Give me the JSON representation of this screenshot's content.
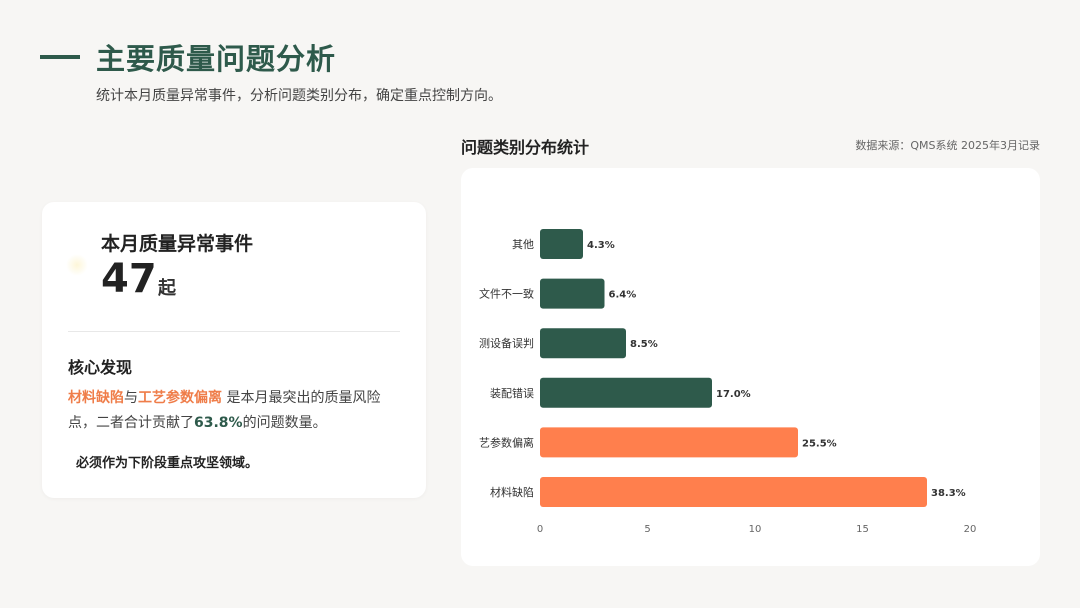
{
  "header": {
    "title": "主要质量问题分析",
    "subtitle": "统计本月质量异常事件，分析问题类别分布，确定重点控制方向。"
  },
  "summary_card": {
    "metric_label": "本月质量异常事件",
    "metric_value": "47",
    "metric_unit": "起",
    "core_title": "核心发现",
    "finding": {
      "item1": "材料缺陷",
      "conj": "与",
      "item2": "工艺参数偏离",
      "mid": " 是本月最突出的质量风险点，二者合计贡献了",
      "percent": "63.8%",
      "end": "的问题数量。"
    },
    "note": "必须作为下阶段重点攻坚领域。"
  },
  "chart_panel": {
    "title": "问题类别分布统计",
    "source": "数据来源：QMS系统 2025年3月记录"
  },
  "colors": {
    "primary_green": "#2e5a4b",
    "accent_orange": "#ff7f4d"
  },
  "chart_data": {
    "type": "bar",
    "orientation": "horizontal",
    "categories": [
      "其他",
      "文件不一致",
      "测设备误判",
      "装配错误",
      "艺参数偏离",
      "材料缺陷"
    ],
    "values": [
      2,
      3,
      4,
      8,
      12,
      18
    ],
    "labels": [
      "4.3%",
      "6.4%",
      "8.5%",
      "17.0%",
      "25.5%",
      "38.3%"
    ],
    "bar_colors": [
      "#2e5a4b",
      "#2e5a4b",
      "#2e5a4b",
      "#2e5a4b",
      "#ff7f4d",
      "#ff7f4d"
    ],
    "x_ticks": [
      "0",
      "5",
      "10",
      "15",
      "20"
    ],
    "xlim": [
      0,
      20
    ],
    "grid": false,
    "legend": "none"
  }
}
